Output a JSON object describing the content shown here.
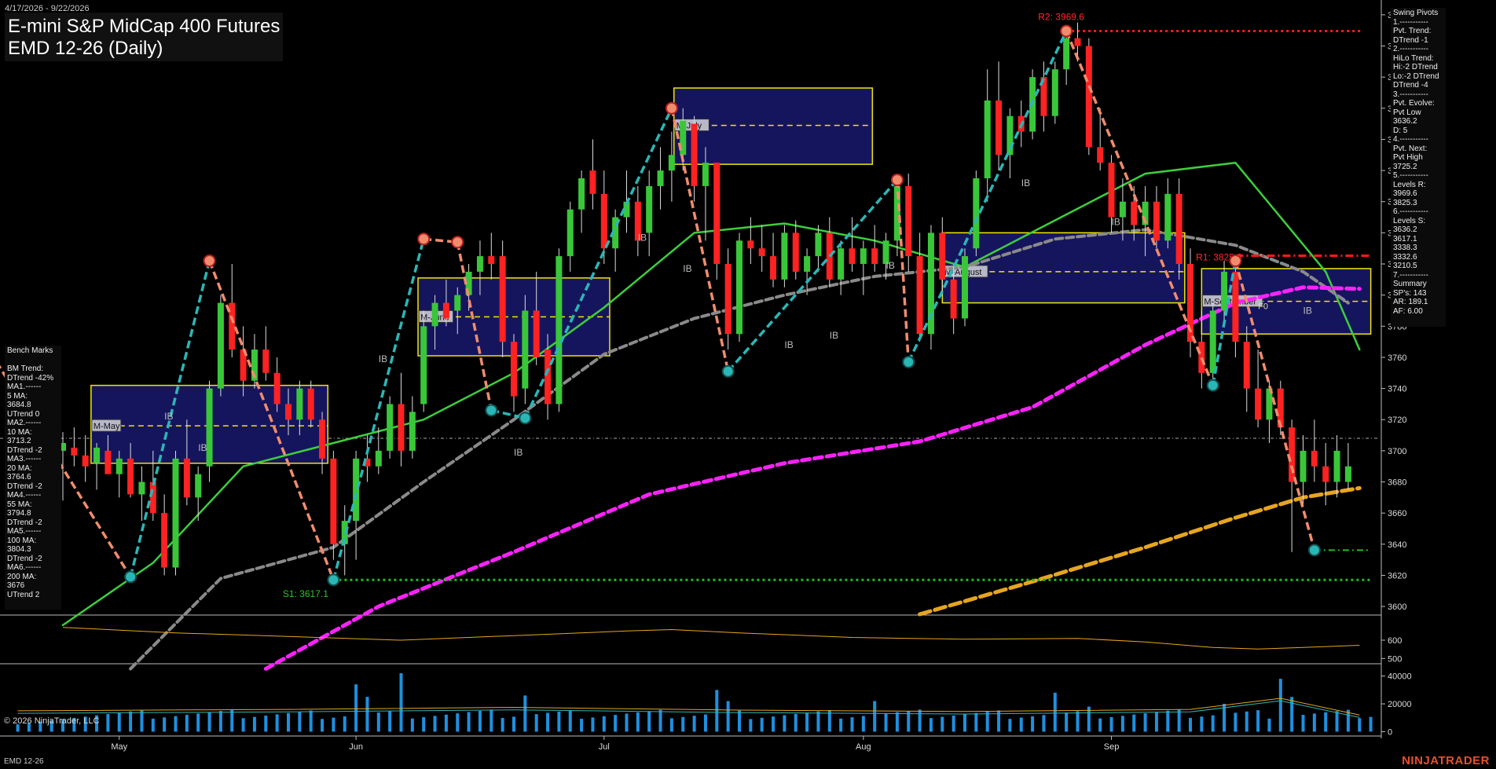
{
  "header": {
    "date_range": "4/17/2026 - 9/22/2026",
    "title": "E-mini S&P MidCap 400 Futures",
    "subtitle": "EMD 12-26 (Daily)"
  },
  "footer": {
    "copyright": "© 2026 NinjaTrader, LLC",
    "instrument": "EMD 12-26",
    "brand": "NINJATRADER"
  },
  "swing_pivots_panel": [
    "Swing Pivots",
    "1.-----------",
    "Pvt. Trend:",
    "DTrend -1",
    "2.-----------",
    "HiLo Trend:",
    "Hi:-2 DTrend",
    "Lo:-2 DTrend",
    "DTrend -4",
    "3.-----------",
    "Pvt. Evolve:",
    "Pvt Low",
    "3636.2",
    "D: 5",
    "4.-----------",
    "Pvt. Next:",
    "Pvt High",
    "3725.2",
    "5.-----------",
    "Levels R:",
    "3969.6",
    "3825.3",
    "6.-----------",
    "Levels S:",
    "3636.2",
    "3617.1",
    "3338.3",
    "3332.6",
    "3210.5",
    "7.-----------",
    "Summary",
    "SP's: 143",
    "AR: 189.1",
    "AF: 6.00"
  ],
  "bench_marks_panel": [
    "Bench Marks",
    "",
    "BM Trend:",
    "DTrend -42%",
    "MA1.------",
    "5 MA:",
    "3684.8",
    "UTrend 0",
    "MA2.------",
    "10 MA:",
    "3713.2",
    "DTrend -2",
    "MA3.------",
    "20 MA:",
    "3764.6",
    "DTrend -2",
    "MA4.------",
    "55 MA:",
    "3794.8",
    "DTrend -2",
    "MA5.------",
    "100 MA:",
    "3804.3",
    "DTrend -2",
    "MA6.------",
    "200 MA:",
    "3676",
    "UTrend 2"
  ],
  "colors": {
    "up": "#39c739",
    "down": "#ff2222",
    "ma_green": "#3ccf3c",
    "ma_gray": "#8a8a8a",
    "ma_magenta": "#ff22ff",
    "ma_gold": "#e6a520",
    "zz_up": "#2bb6b6",
    "zz_down": "#f08c6c",
    "box_fill": "#15155e",
    "box_border": "#f2e600",
    "resistance": "#ff1a1a",
    "support": "#1bbf1b"
  },
  "chart_data": {
    "type": "candlestick",
    "instrument": "EMD 12-26",
    "period": "Daily",
    "x_tick_labels": [
      "May",
      "Jun",
      "Jul",
      "Aug",
      "Sep"
    ],
    "y_ticks": [
      3600,
      3620,
      3640,
      3660,
      3680,
      3700,
      3720,
      3740,
      3760,
      3780,
      3800,
      3820,
      3840,
      3860,
      3880,
      3900,
      3920,
      3940,
      3960,
      3980
    ],
    "ylim": [
      3595,
      3987
    ],
    "candles": [
      [
        3700,
        3712,
        3668,
        3705
      ],
      [
        3702,
        3715,
        3690,
        3697
      ],
      [
        3697,
        3710,
        3680,
        3690
      ],
      [
        3692,
        3705,
        3675,
        3702
      ],
      [
        3700,
        3710,
        3690,
        3685
      ],
      [
        3685,
        3700,
        3670,
        3695
      ],
      [
        3695,
        3705,
        3670,
        3672
      ],
      [
        3672,
        3690,
        3655,
        3680
      ],
      [
        3680,
        3700,
        3655,
        3660
      ],
      [
        3660,
        3672,
        3620,
        3625
      ],
      [
        3625,
        3700,
        3620,
        3695
      ],
      [
        3695,
        3720,
        3665,
        3670
      ],
      [
        3670,
        3690,
        3655,
        3685
      ],
      [
        3690,
        3745,
        3680,
        3740
      ],
      [
        3740,
        3800,
        3735,
        3795
      ],
      [
        3795,
        3820,
        3760,
        3765
      ],
      [
        3765,
        3780,
        3735,
        3745
      ],
      [
        3745,
        3775,
        3740,
        3765
      ],
      [
        3765,
        3780,
        3745,
        3750
      ],
      [
        3750,
        3760,
        3725,
        3730
      ],
      [
        3730,
        3740,
        3710,
        3720
      ],
      [
        3720,
        3745,
        3710,
        3740
      ],
      [
        3740,
        3745,
        3715,
        3720
      ],
      [
        3720,
        3725,
        3685,
        3695
      ],
      [
        3695,
        3700,
        3630,
        3640
      ],
      [
        3640,
        3665,
        3620,
        3655
      ],
      [
        3655,
        3700,
        3630,
        3695
      ],
      [
        3695,
        3710,
        3680,
        3690
      ],
      [
        3690,
        3715,
        3685,
        3700
      ],
      [
        3700,
        3735,
        3695,
        3730
      ],
      [
        3730,
        3750,
        3690,
        3700
      ],
      [
        3700,
        3735,
        3695,
        3725
      ],
      [
        3730,
        3790,
        3725,
        3780
      ],
      [
        3780,
        3800,
        3765,
        3795
      ],
      [
        3795,
        3810,
        3780,
        3785
      ],
      [
        3790,
        3805,
        3775,
        3800
      ],
      [
        3800,
        3820,
        3790,
        3815
      ],
      [
        3815,
        3835,
        3800,
        3825
      ],
      [
        3825,
        3840,
        3810,
        3820
      ],
      [
        3825,
        3835,
        3760,
        3770
      ],
      [
        3770,
        3775,
        3725,
        3735
      ],
      [
        3740,
        3800,
        3730,
        3790
      ],
      [
        3790,
        3815,
        3755,
        3760
      ],
      [
        3765,
        3775,
        3720,
        3730
      ],
      [
        3730,
        3830,
        3725,
        3825
      ],
      [
        3825,
        3860,
        3815,
        3855
      ],
      [
        3855,
        3880,
        3840,
        3875
      ],
      [
        3880,
        3900,
        3855,
        3865
      ],
      [
        3865,
        3880,
        3820,
        3830
      ],
      [
        3830,
        3855,
        3815,
        3850
      ],
      [
        3850,
        3880,
        3840,
        3860
      ],
      [
        3860,
        3870,
        3825,
        3835
      ],
      [
        3840,
        3880,
        3825,
        3870
      ],
      [
        3870,
        3895,
        3855,
        3880
      ],
      [
        3880,
        3905,
        3860,
        3890
      ],
      [
        3890,
        3920,
        3880,
        3912
      ],
      [
        3910,
        3915,
        3860,
        3870
      ],
      [
        3870,
        3895,
        3835,
        3885
      ],
      [
        3885,
        3885,
        3810,
        3820
      ],
      [
        3820,
        3830,
        3765,
        3775
      ],
      [
        3775,
        3840,
        3770,
        3835
      ],
      [
        3835,
        3850,
        3820,
        3830
      ],
      [
        3830,
        3845,
        3815,
        3825
      ],
      [
        3825,
        3840,
        3805,
        3810
      ],
      [
        3810,
        3845,
        3805,
        3840
      ],
      [
        3840,
        3848,
        3810,
        3815
      ],
      [
        3815,
        3830,
        3800,
        3825
      ],
      [
        3825,
        3845,
        3815,
        3840
      ],
      [
        3840,
        3850,
        3805,
        3810
      ],
      [
        3810,
        3835,
        3800,
        3830
      ],
      [
        3830,
        3850,
        3815,
        3820
      ],
      [
        3820,
        3835,
        3800,
        3830
      ],
      [
        3830,
        3845,
        3815,
        3820
      ],
      [
        3820,
        3840,
        3810,
        3835
      ],
      [
        3835,
        3875,
        3825,
        3870
      ],
      [
        3870,
        3878,
        3815,
        3825
      ],
      [
        3825,
        3840,
        3770,
        3775
      ],
      [
        3775,
        3845,
        3765,
        3840
      ],
      [
        3840,
        3850,
        3800,
        3810
      ],
      [
        3810,
        3820,
        3775,
        3785
      ],
      [
        3785,
        3830,
        3780,
        3825
      ],
      [
        3830,
        3880,
        3825,
        3875
      ],
      [
        3875,
        3945,
        3860,
        3925
      ],
      [
        3925,
        3950,
        3880,
        3890
      ],
      [
        3890,
        3920,
        3875,
        3915
      ],
      [
        3915,
        3925,
        3895,
        3905
      ],
      [
        3905,
        3945,
        3900,
        3940
      ],
      [
        3940,
        3950,
        3905,
        3915
      ],
      [
        3915,
        3950,
        3910,
        3945
      ],
      [
        3945,
        3970,
        3935,
        3965
      ],
      [
        3965,
        3975,
        3950,
        3960
      ],
      [
        3960,
        3965,
        3890,
        3895
      ],
      [
        3895,
        3920,
        3880,
        3885
      ],
      [
        3885,
        3890,
        3840,
        3850
      ],
      [
        3850,
        3875,
        3835,
        3860
      ],
      [
        3860,
        3870,
        3835,
        3845
      ],
      [
        3845,
        3870,
        3825,
        3860
      ],
      [
        3860,
        3870,
        3830,
        3835
      ],
      [
        3835,
        3875,
        3830,
        3865
      ],
      [
        3865,
        3875,
        3810,
        3820
      ],
      [
        3820,
        3830,
        3760,
        3770
      ],
      [
        3770,
        3790,
        3740,
        3750
      ],
      [
        3750,
        3795,
        3745,
        3790
      ],
      [
        3790,
        3822,
        3780,
        3815
      ],
      [
        3815,
        3825,
        3760,
        3770
      ],
      [
        3770,
        3780,
        3725,
        3740
      ],
      [
        3740,
        3765,
        3715,
        3720
      ],
      [
        3720,
        3745,
        3705,
        3740
      ],
      [
        3740,
        3745,
        3710,
        3715
      ],
      [
        3715,
        3720,
        3635,
        3680
      ],
      [
        3680,
        3710,
        3665,
        3700
      ],
      [
        3700,
        3720,
        3680,
        3690
      ],
      [
        3690,
        3705,
        3665,
        3680
      ],
      [
        3680,
        3710,
        3670,
        3700
      ],
      [
        3680,
        3705,
        3675,
        3690
      ]
    ],
    "moving_averages": [
      {
        "name": "20 MA",
        "values": [
          [
            0,
            3588
          ],
          [
            8,
            3628
          ],
          [
            16,
            3690
          ],
          [
            24,
            3705
          ],
          [
            32,
            3720
          ],
          [
            40,
            3750
          ],
          [
            48,
            3792
          ],
          [
            56,
            3840
          ],
          [
            64,
            3846
          ],
          [
            72,
            3835
          ],
          [
            80,
            3818
          ],
          [
            88,
            3848
          ],
          [
            96,
            3878
          ],
          [
            104,
            3885
          ],
          [
            112,
            3815
          ],
          [
            115,
            3765
          ]
        ]
      },
      {
        "name": "55 MA",
        "values": [
          [
            6,
            3560
          ],
          [
            14,
            3618
          ],
          [
            24,
            3638
          ],
          [
            32,
            3680
          ],
          [
            40,
            3720
          ],
          [
            48,
            3762
          ],
          [
            56,
            3785
          ],
          [
            64,
            3800
          ],
          [
            72,
            3812
          ],
          [
            80,
            3818
          ],
          [
            88,
            3836
          ],
          [
            96,
            3842
          ],
          [
            104,
            3832
          ],
          [
            110,
            3815
          ],
          [
            114,
            3795
          ]
        ]
      },
      {
        "name": "100 MA",
        "values": [
          [
            18,
            3560
          ],
          [
            28,
            3600
          ],
          [
            40,
            3635
          ],
          [
            52,
            3672
          ],
          [
            64,
            3692
          ],
          [
            76,
            3706
          ],
          [
            86,
            3728
          ],
          [
            96,
            3768
          ],
          [
            104,
            3795
          ],
          [
            110,
            3805
          ],
          [
            115,
            3804
          ]
        ]
      },
      {
        "name": "200 MA",
        "values": [
          [
            76,
            3595
          ],
          [
            86,
            3616
          ],
          [
            96,
            3638
          ],
          [
            104,
            3657
          ],
          [
            110,
            3670
          ],
          [
            115,
            3676
          ]
        ]
      }
    ],
    "swing_points": {
      "highs": [
        [
          -7,
          3770
        ],
        [
          13,
          3822
        ],
        [
          32,
          3836
        ],
        [
          35,
          3834
        ],
        [
          54,
          3920
        ],
        [
          74,
          3874
        ],
        [
          89,
          3969.6
        ],
        [
          104,
          3822
        ]
      ],
      "lows": [
        [
          6,
          3619
        ],
        [
          24,
          3617.1
        ],
        [
          38,
          3726
        ],
        [
          41,
          3721
        ],
        [
          59,
          3751
        ],
        [
          75,
          3757
        ],
        [
          102,
          3742
        ],
        [
          111,
          3636.2
        ]
      ]
    },
    "sessions": [
      {
        "label": "M-May",
        "x": [
          2.5,
          23.5
        ],
        "y": [
          3692,
          3742
        ],
        "mid": 3716
      },
      {
        "label": "M-June",
        "x": [
          31.5,
          48.5
        ],
        "y": [
          3761,
          3811
        ],
        "mid": 3786
      },
      {
        "label": "M-July",
        "x": [
          54.2,
          71.8
        ],
        "y": [
          3884,
          3933
        ],
        "mid": 3909
      },
      {
        "label": "M-August",
        "x": [
          78,
          99.5
        ],
        "y": [
          3795,
          3840
        ],
        "mid": 3815
      },
      {
        "label": "M-September",
        "x": [
          101,
          116
        ],
        "y": [
          3775,
          3817
        ],
        "mid": 3796
      }
    ],
    "levels": {
      "R2": {
        "label": "R2: 3969.6",
        "value": 3969.6
      },
      "R1": {
        "label": "R1: 3825.3",
        "value": 3825.3
      },
      "S1": {
        "label": "S1: 3617.1",
        "value": 3617.1
      },
      "pivot_low": 3636.2,
      "current": 3708
    },
    "markers": [
      "IB",
      "F0"
    ],
    "month_ticks": {
      "May": 5,
      "Jun": 26,
      "Jul": 48,
      "Aug": 71,
      "Sep": 93
    },
    "panel2": {
      "y_ticks": [
        600,
        500
      ],
      "ylim": [
        480,
        720
      ],
      "series": [
        [
          0,
          670
        ],
        [
          10,
          640
        ],
        [
          20,
          620
        ],
        [
          30,
          600
        ],
        [
          40,
          625
        ],
        [
          50,
          650
        ],
        [
          54,
          658
        ],
        [
          60,
          640
        ],
        [
          70,
          615
        ],
        [
          80,
          605
        ],
        [
          90,
          610
        ],
        [
          96,
          590
        ],
        [
          102,
          560
        ],
        [
          106,
          552
        ],
        [
          110,
          560
        ],
        [
          115,
          572
        ]
      ]
    },
    "volume_panel": {
      "y_ticks": [
        40000,
        20000,
        0
      ],
      "ylim": [
        -2000,
        46000
      ]
    }
  }
}
